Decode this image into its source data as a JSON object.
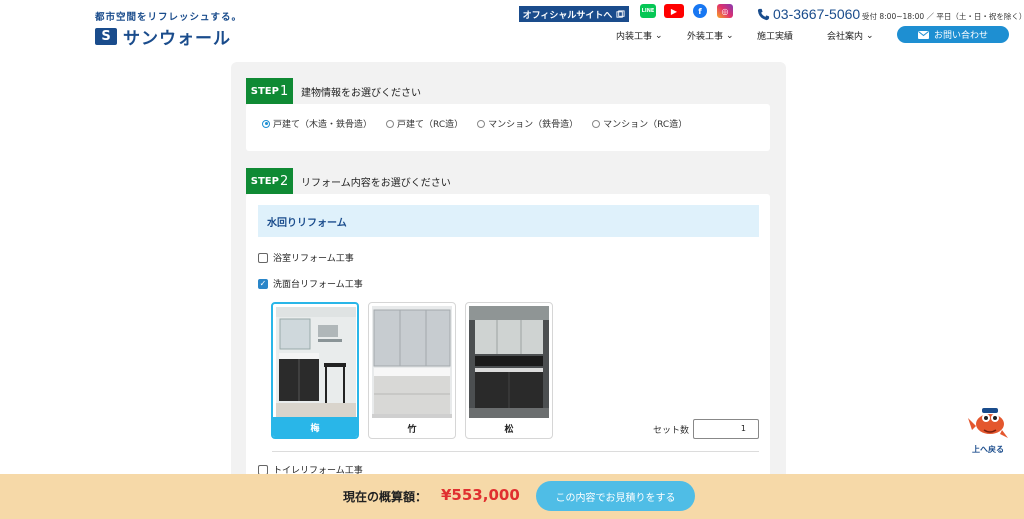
{
  "header": {
    "tagline": "都市空間をリフレッシュする。",
    "logo_text": "サンウォール",
    "logo_mark": "S",
    "official_site": "オフィシャルサイトへ",
    "sns": {
      "line": "LINE",
      "youtube": "▶",
      "facebook": "f",
      "instagram": "◎"
    },
    "phone": "03-3667-5060",
    "hours": "受付 8:00~18:00 ／ 平日（土・日・祝を除く）",
    "nav": [
      "内装工事",
      "外装工事",
      "施工実績",
      "会社案内"
    ],
    "contact": "お問い合わせ"
  },
  "step1": {
    "badge": "STEP",
    "num": "1",
    "title": "建物情報をお選びください",
    "options": [
      "戸建て（木造・鉄骨造）",
      "戸建て（RC造）",
      "マンション（鉄骨造）",
      "マンション（RC造）"
    ],
    "selected_index": 0
  },
  "step2": {
    "badge": "STEP",
    "num": "2",
    "title": "リフォーム内容をお選びください",
    "category": "水回りリフォーム",
    "items": [
      {
        "label": "浴室リフォーム工事",
        "checked": false
      },
      {
        "label": "洗面台リフォーム工事",
        "checked": true
      },
      {
        "label": "トイレリフォーム工事",
        "checked": false
      }
    ],
    "grades": [
      "梅",
      "竹",
      "松"
    ],
    "selected_grade": "梅",
    "qty_label": "セット数",
    "qty_value": "1"
  },
  "back_top": "上へ戻る",
  "footer": {
    "estimate_label": "現在の概算額：",
    "estimate_value": "¥553,000",
    "quote_button": "この内容でお見積りをする"
  },
  "colors": {
    "brand": "#1a4c8c",
    "step_green": "#0f8a34",
    "accent_blue": "#29b6e8",
    "price_red": "#e03030",
    "footer_bg": "#f6d9a8"
  }
}
